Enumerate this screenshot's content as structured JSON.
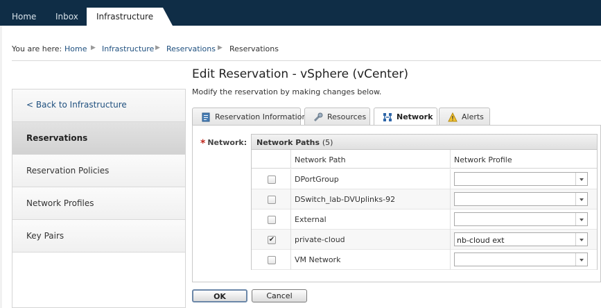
{
  "topnav": {
    "tabs": [
      {
        "label": "Home"
      },
      {
        "label": "Inbox"
      },
      {
        "label": "Infrastructure"
      }
    ]
  },
  "breadcrumb": {
    "prefix": "You are here:",
    "items": [
      "Home",
      "Infrastructure",
      "Reservations",
      "Reservations"
    ]
  },
  "sidebar": {
    "back": "< Back to Infrastructure",
    "items": [
      {
        "label": "Reservations"
      },
      {
        "label": "Reservation Policies"
      },
      {
        "label": "Network Profiles"
      },
      {
        "label": "Key Pairs"
      }
    ]
  },
  "main": {
    "title": "Edit Reservation - vSphere (vCenter)",
    "subtitle": "Modify the reservation by making changes below.",
    "tabs": [
      {
        "label": "Reservation Information",
        "icon": "document-icon"
      },
      {
        "label": "Resources",
        "icon": "wrench-icon"
      },
      {
        "label": "Network",
        "icon": "network-icon"
      },
      {
        "label": "Alerts",
        "icon": "warning-icon"
      }
    ],
    "network_label": "Network:",
    "grid": {
      "title": "Network Paths",
      "count": "(5)",
      "columns": [
        "Network Path",
        "Network Profile"
      ],
      "rows": [
        {
          "path": "DPortGroup",
          "checked": false,
          "profile": ""
        },
        {
          "path": "DSwitch_lab-DVUplinks-92",
          "checked": false,
          "profile": ""
        },
        {
          "path": "External",
          "checked": false,
          "profile": ""
        },
        {
          "path": "private-cloud",
          "checked": true,
          "profile": "nb-cloud ext"
        },
        {
          "path": "VM Network",
          "checked": false,
          "profile": ""
        }
      ]
    },
    "ok_label": "OK",
    "cancel_label": "Cancel"
  },
  "colors": {
    "nav_bg": "#0f2d46",
    "link": "#1e4f7e",
    "required": "#c0281e"
  }
}
